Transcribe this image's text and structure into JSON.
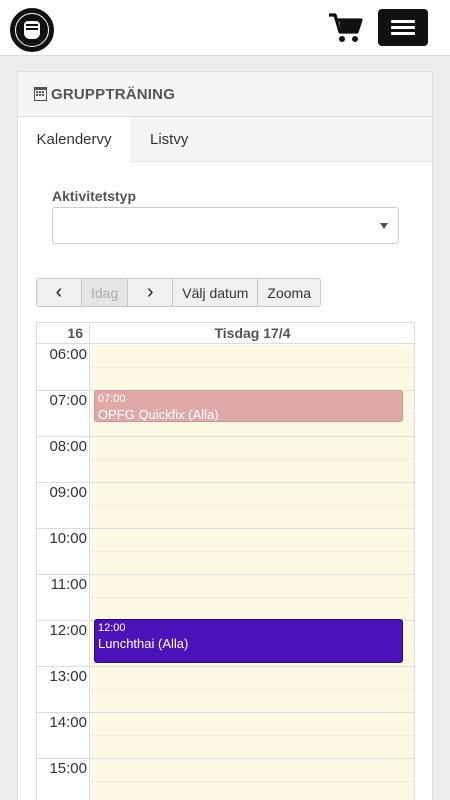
{
  "header": {
    "logo": "club-logo",
    "cart_icon": "cart-icon",
    "menu_icon": "hamburger-menu-icon"
  },
  "panel": {
    "title": "GRUPPTRÄNING",
    "title_icon": "calendar-icon"
  },
  "tabs": [
    {
      "label": "Kalendervy",
      "active": true
    },
    {
      "label": "Listvy",
      "active": false
    }
  ],
  "filter": {
    "label": "Aktivitetstyp",
    "value": ""
  },
  "toolbar": {
    "prev": "‹",
    "today": "Idag",
    "next": "›",
    "choose_date": "Välj datum",
    "zoom": "Zooma"
  },
  "calendar": {
    "week": "16",
    "day": "Tisdag 17/4",
    "times": [
      "06:00",
      "07:00",
      "08:00",
      "09:00",
      "10:00",
      "11:00",
      "12:00",
      "13:00",
      "14:00",
      "15:00"
    ],
    "events": [
      {
        "time": "07:00",
        "title": "OPFG Quickfix (Alla)",
        "color": "#e0a9a9"
      },
      {
        "time": "12:00",
        "title": "Lunchthai (Alla)",
        "color": "#4a12b8"
      }
    ]
  },
  "colors": {
    "day_bg": "#fcf8e3",
    "menu_button": "#111111"
  }
}
